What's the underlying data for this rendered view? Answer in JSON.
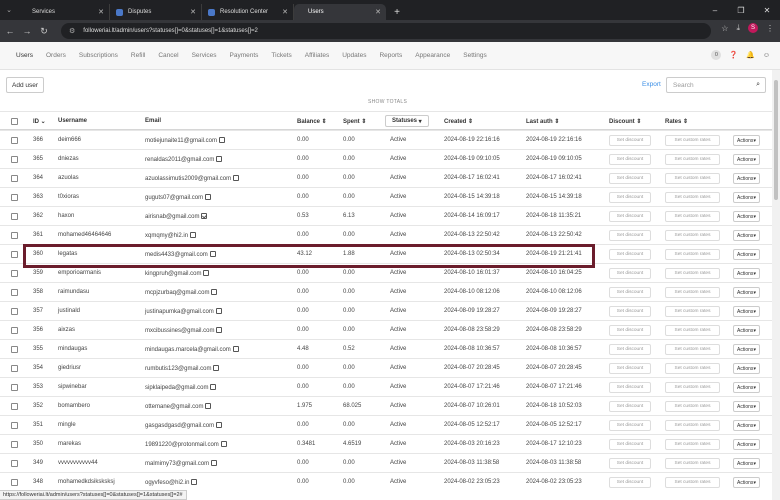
{
  "browser": {
    "tabs": [
      {
        "title": "Services",
        "favicon": false
      },
      {
        "title": "Disputes",
        "favicon": true
      },
      {
        "title": "Resolution Center",
        "favicon": true
      },
      {
        "title": "Users",
        "favicon": false,
        "active": true
      }
    ],
    "url": "followeriai.lt/admin/users?statuses[]=0&statuses[]=1&statuses[]=2",
    "profile_initial": "S",
    "status_url": "https://followeriai.lt/admin/users?statuses[]=0&statuses[]=1&statuses[]=2#"
  },
  "nav": {
    "items": [
      "Users",
      "Orders",
      "Subscriptions",
      "Refill",
      "Cancel",
      "Services",
      "Payments",
      "Tickets",
      "Affiliates",
      "Updates",
      "Reports",
      "Appearance",
      "Settings"
    ],
    "active": "Users",
    "notification_count": "0"
  },
  "toolbar": {
    "add_user": "Add user",
    "export": "Export",
    "search_placeholder": "Search",
    "show_totals": "SHOW TOTALS"
  },
  "table": {
    "headers": {
      "id": "ID",
      "username": "Username",
      "email": "Email",
      "balance": "Balance",
      "spent": "Spent",
      "statuses": "Statuses",
      "created": "Created",
      "last_auth": "Last auth",
      "discount": "Discount",
      "rates": "Rates"
    },
    "set_discount": "Set discount",
    "set_rates": "Set custom rates",
    "actions": "Actions",
    "highlighted_id": "360",
    "rows": [
      {
        "id": "366",
        "username": "deim666",
        "email": "motiejunaite11@gmail.com",
        "verified": false,
        "balance": "0.00",
        "spent": "0.00",
        "status": "Active",
        "created": "2024-08-19 22:16:16",
        "last_auth": "2024-08-19 22:16:16"
      },
      {
        "id": "365",
        "username": "dniezas",
        "email": "renaldas2011@gmail.com",
        "verified": false,
        "balance": "0.00",
        "spent": "0.00",
        "status": "Active",
        "created": "2024-08-19 09:10:05",
        "last_auth": "2024-08-19 09:10:05"
      },
      {
        "id": "364",
        "username": "azuolas",
        "email": "azuolassimutis2009@gmail.com",
        "verified": false,
        "balance": "0.00",
        "spent": "0.00",
        "status": "Active",
        "created": "2024-08-17 16:02:41",
        "last_auth": "2024-08-17 16:02:41"
      },
      {
        "id": "363",
        "username": "t0xioras",
        "email": "guguts07@gmail.com",
        "verified": false,
        "balance": "0.00",
        "spent": "0.00",
        "status": "Active",
        "created": "2024-08-15 14:39:18",
        "last_auth": "2024-08-15 14:39:18"
      },
      {
        "id": "362",
        "username": "haxon",
        "email": "airisnab@gmail.com",
        "verified": true,
        "balance": "0.53",
        "spent": "6.13",
        "status": "Active",
        "created": "2024-08-14 16:09:17",
        "last_auth": "2024-08-18 11:35:21"
      },
      {
        "id": "361",
        "username": "mohamed46464646",
        "email": "xqmqmy@hi2.in",
        "verified": false,
        "balance": "0.00",
        "spent": "0.00",
        "status": "Active",
        "created": "2024-08-13 22:50:42",
        "last_auth": "2024-08-13 22:50:42"
      },
      {
        "id": "360",
        "username": "legatas",
        "email": "medis4433@gmail.com",
        "verified": false,
        "balance": "43.12",
        "spent": "1.88",
        "status": "Active",
        "created": "2024-08-13 02:50:34",
        "last_auth": "2024-08-19 21:21:41"
      },
      {
        "id": "359",
        "username": "emporioarmanis",
        "email": "kingpruh@gmail.com",
        "verified": false,
        "balance": "0.00",
        "spent": "0.00",
        "status": "Active",
        "created": "2024-08-10 16:01:37",
        "last_auth": "2024-08-10 16:04:25"
      },
      {
        "id": "358",
        "username": "raimundasu",
        "email": "mcpjzurbaq@gmail.com",
        "verified": false,
        "balance": "0.00",
        "spent": "0.00",
        "status": "Active",
        "created": "2024-08-10 08:12:06",
        "last_auth": "2024-08-10 08:12:06"
      },
      {
        "id": "357",
        "username": "justinald",
        "email": "justinapumka@gmail.com",
        "verified": false,
        "balance": "0.00",
        "spent": "0.00",
        "status": "Active",
        "created": "2024-08-09 19:28:27",
        "last_auth": "2024-08-09 19:28:27"
      },
      {
        "id": "356",
        "username": "aixzas",
        "email": "mxcibussines@gmail.com",
        "verified": false,
        "balance": "0.00",
        "spent": "0.00",
        "status": "Active",
        "created": "2024-08-08 23:58:29",
        "last_auth": "2024-08-08 23:58:29"
      },
      {
        "id": "355",
        "username": "mindaugas",
        "email": "mindaugas.marcela@gmail.com",
        "verified": false,
        "balance": "4.48",
        "spent": "0.52",
        "status": "Active",
        "created": "2024-08-08 10:36:57",
        "last_auth": "2024-08-08 10:36:57"
      },
      {
        "id": "354",
        "username": "giedriusr",
        "email": "rumbutis123@gmail.com",
        "verified": false,
        "balance": "0.00",
        "spent": "0.00",
        "status": "Active",
        "created": "2024-08-07 20:28:45",
        "last_auth": "2024-08-07 20:28:45"
      },
      {
        "id": "353",
        "username": "sipwinebar",
        "email": "sipklaipeda@gmail.com",
        "verified": false,
        "balance": "0.00",
        "spent": "0.00",
        "status": "Active",
        "created": "2024-08-07 17:21:46",
        "last_auth": "2024-08-07 17:21:46"
      },
      {
        "id": "352",
        "username": "bomambero",
        "email": "ottemane@gmail.com",
        "verified": false,
        "balance": "1.975",
        "spent": "68.025",
        "status": "Active",
        "created": "2024-08-07 10:26:01",
        "last_auth": "2024-08-18 10:52:03"
      },
      {
        "id": "351",
        "username": "mingle",
        "email": "gasgasdgasd@gmail.com",
        "verified": false,
        "balance": "0.00",
        "spent": "0.00",
        "status": "Active",
        "created": "2024-08-05 12:52:17",
        "last_auth": "2024-08-05 12:52:17"
      },
      {
        "id": "350",
        "username": "marekas",
        "email": "19891220@protonmail.com",
        "verified": false,
        "balance": "0.3481",
        "spent": "4.6519",
        "status": "Active",
        "created": "2024-08-03 20:16:23",
        "last_auth": "2024-08-17 12:10:23"
      },
      {
        "id": "349",
        "username": "vvvvvvvvvvv44",
        "email": "malmimy73@gmail.com",
        "verified": false,
        "balance": "0.00",
        "spent": "0.00",
        "status": "Active",
        "created": "2024-08-03 11:38:58",
        "last_auth": "2024-08-03 11:38:58"
      },
      {
        "id": "348",
        "username": "mohamedkdsiksksksj",
        "email": "ogyvfeso@hi2.in",
        "verified": false,
        "balance": "0.00",
        "spent": "0.00",
        "status": "Active",
        "created": "2024-08-02 23:05:23",
        "last_auth": "2024-08-02 23:05:23"
      }
    ]
  }
}
